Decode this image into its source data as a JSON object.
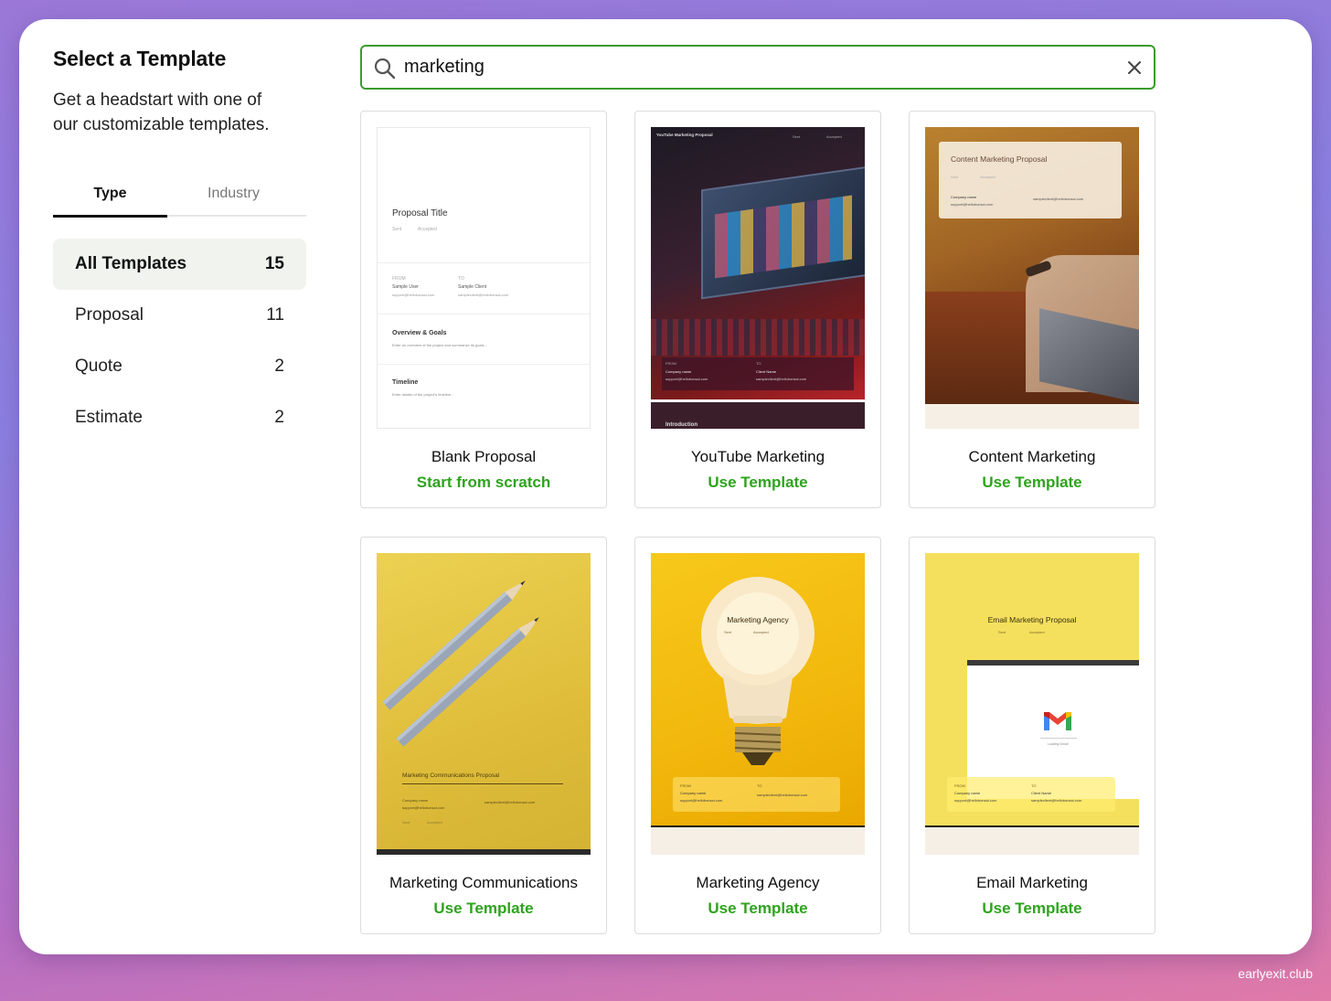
{
  "sidebar": {
    "title": "Select a Template",
    "subtitle_line1": "Get a headstart with one of",
    "subtitle_line2": "our customizable templates.",
    "tabs": [
      {
        "label": "Type",
        "active": true
      },
      {
        "label": "Industry",
        "active": false
      }
    ],
    "categories": [
      {
        "label": "All Templates",
        "count": "15",
        "active": true
      },
      {
        "label": "Proposal",
        "count": "11",
        "active": false
      },
      {
        "label": "Quote",
        "count": "2",
        "active": false
      },
      {
        "label": "Estimate",
        "count": "2",
        "active": false
      }
    ]
  },
  "search": {
    "value": "marketing",
    "icon": "search-icon",
    "clear_icon": "close-icon"
  },
  "cards": [
    {
      "name": "Blank Proposal",
      "action": "Start from scratch",
      "preview": {
        "title": "Proposal Title",
        "sent": "Sent",
        "accepted": "Accepted",
        "from": "FROM",
        "to": "TO",
        "sample_user": "Sample User",
        "sample_client": "Sample Client",
        "user_email": "support@hellobonsai.com",
        "client_email": "sampleclient@hellobonsai.com",
        "section1": "Overview & Goals",
        "section1_text": "Enter an overview of the project and summarize its goals...",
        "section2": "Timeline",
        "section2_text": "Enter details of the project's timeline..."
      }
    },
    {
      "name": "YouTube Marketing",
      "action": "Use Template",
      "preview": {
        "title": "YouTube Marketing Proposal",
        "sent": "Sent",
        "accepted": "Accepted",
        "from": "FROM",
        "to": "TO",
        "company": "Company name",
        "client": "Client Name",
        "user_email": "support@hellobonsai.com",
        "client_email": "sampleclient@hellobonsai.com",
        "section": "Introduction"
      }
    },
    {
      "name": "Content Marketing",
      "action": "Use Template",
      "preview": {
        "title": "Content Marketing Proposal",
        "sent": "Sent",
        "accepted": "Accepted",
        "company": "Company name",
        "user_email": "support@hellobonsai.com",
        "client_email": "sampleclient@hellobonsai.com"
      }
    },
    {
      "name": "Marketing Communications",
      "action": "Use Template",
      "preview": {
        "title": "Marketing Communications Proposal",
        "company": "Company name",
        "user_email": "support@hellobonsai.com",
        "client_email": "sampleclient@hellobonsai.com",
        "sent": "Sent",
        "accepted": "Accepted"
      }
    },
    {
      "name": "Marketing Agency",
      "action": "Use Template",
      "preview": {
        "title": "Marketing Agency",
        "sent": "Sent",
        "accepted": "Accepted",
        "from": "FROM",
        "to": "TO",
        "company": "Company name",
        "user_email": "support@hellobonsai.com",
        "client_email": "sampleclient@hellobonsai.com"
      }
    },
    {
      "name": "Email Marketing",
      "action": "Use Template",
      "preview": {
        "title": "Email Marketing Proposal",
        "sent": "Sent",
        "accepted": "Accepted",
        "from": "FROM",
        "to": "TO",
        "company": "Company name",
        "client": "Client Name",
        "user_email": "support@hellobonsai.com",
        "client_email": "sampleclient@hellobonsai.com",
        "loading": "Loading Gmail"
      }
    }
  ],
  "colors": {
    "accent_green": "#2ea31e",
    "search_border": "#3a9c2c",
    "active_category_bg": "#f1f3ef"
  },
  "watermark": "earlyexit.club"
}
